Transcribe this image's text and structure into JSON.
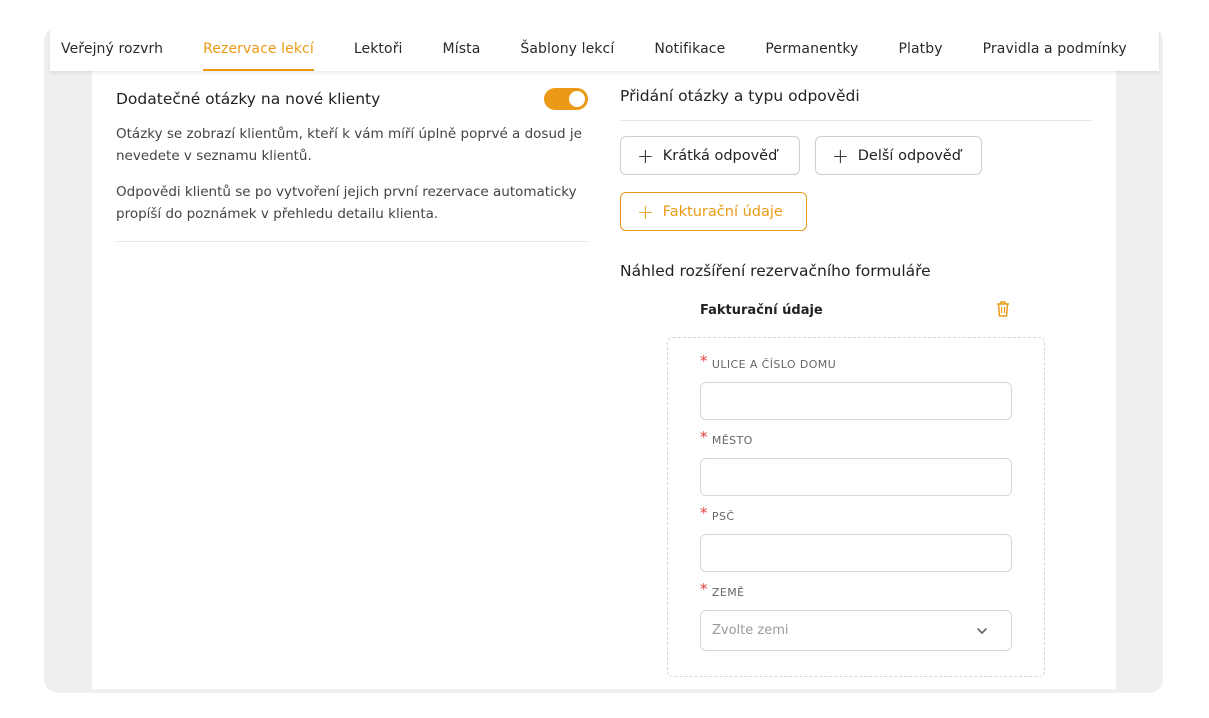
{
  "tabs": [
    {
      "label": "Veřejný rozvrh",
      "active": false
    },
    {
      "label": "Rezervace lekcí",
      "active": true
    },
    {
      "label": "Lektoři",
      "active": false
    },
    {
      "label": "Místa",
      "active": false
    },
    {
      "label": "Šablony lekcí",
      "active": false
    },
    {
      "label": "Notifikace",
      "active": false
    },
    {
      "label": "Permanentky",
      "active": false
    },
    {
      "label": "Platby",
      "active": false
    },
    {
      "label": "Pravidla a podmínky",
      "active": false
    }
  ],
  "left": {
    "title": "Dodatečné otázky na nové klienty",
    "toggle_on": true,
    "paragraph1": "Otázky se zobrazí klientům, kteří k vám míří úplně poprvé a dosud je nevedete v seznamu klientů.",
    "paragraph2": "Odpovědi klientů se po vytvoření jejich první rezervace automaticky propíší do poznámek v přehledu detailu klienta."
  },
  "right": {
    "title": "Přidání otázky a typu odpovědi",
    "buttons": {
      "short": "Krátká odpověď",
      "long": "Delší odpověď",
      "billing": "Fakturační údaje"
    },
    "plus_symbol": "+",
    "preview_title": "Náhled rozšíření rezervačního formuláře",
    "section_name": "Fakturační údaje",
    "required_mark": "*",
    "fields": {
      "street": "ULICE A ČÍSLO DOMU",
      "city": "MĚSTO",
      "zip": "PSČ",
      "country": "ZEMĚ"
    },
    "country_placeholder": "Zvolte zemi"
  },
  "colors": {
    "accent": "#ea9a16",
    "required": "#e0403a"
  },
  "icons": {
    "plus": "plus-icon",
    "trash": "trash-icon",
    "chevron": "chevron-down-icon"
  }
}
